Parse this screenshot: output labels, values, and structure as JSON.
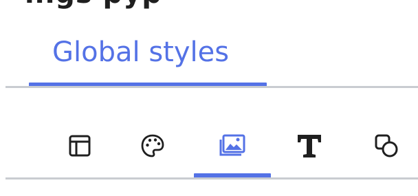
{
  "page": {
    "top_fragment": "ings pyp",
    "global_tab": {
      "label": "Global styles",
      "active": true
    },
    "toolbar": {
      "icons": [
        {
          "name": "layout-icon",
          "active": false
        },
        {
          "name": "palette-icon",
          "active": false
        },
        {
          "name": "image-icon",
          "active": true
        },
        {
          "name": "typography-icon",
          "active": false
        },
        {
          "name": "shapes-icon",
          "active": false
        }
      ]
    },
    "colors": {
      "accent": "#5472e6",
      "divider": "#c9ccd1",
      "icon": "#1f1f1f",
      "background": "#ffffff"
    }
  }
}
